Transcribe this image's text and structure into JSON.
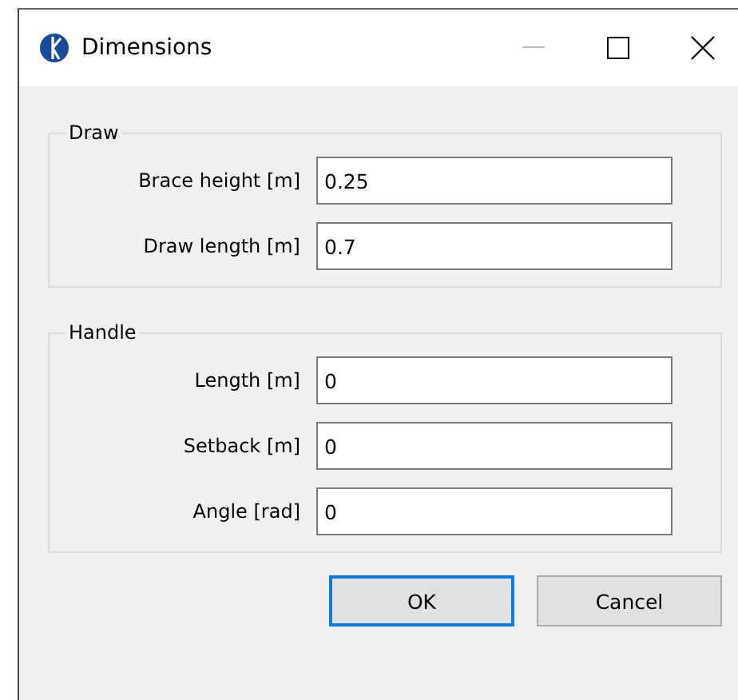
{
  "window": {
    "title": "Dimensions"
  },
  "groups": [
    {
      "title": "Draw",
      "fields": [
        {
          "label": "Brace height [m]",
          "value": "0.25"
        },
        {
          "label": "Draw length [m]",
          "value": "0.7"
        }
      ]
    },
    {
      "title": "Handle",
      "fields": [
        {
          "label": "Length [m]",
          "value": "0"
        },
        {
          "label": "Setback [m]",
          "value": "0"
        },
        {
          "label": "Angle [rad]",
          "value": "0"
        }
      ]
    }
  ],
  "buttons": [
    {
      "label": "OK",
      "default": true
    },
    {
      "label": "Cancel",
      "default": false
    }
  ]
}
